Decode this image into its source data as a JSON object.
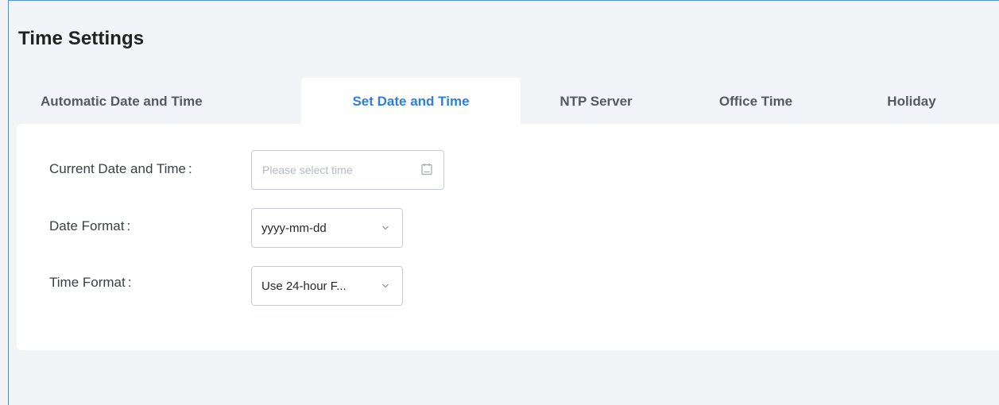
{
  "header": {
    "title": "Time Settings"
  },
  "tabs": [
    {
      "label": "Automatic Date and Time",
      "active": false
    },
    {
      "label": "Set Date and Time",
      "active": true
    },
    {
      "label": "NTP Server",
      "active": false
    },
    {
      "label": "Office Time",
      "active": false
    },
    {
      "label": "Holiday",
      "active": false
    }
  ],
  "form": {
    "current_datetime": {
      "label": "Current Date and Time",
      "colon": ":",
      "placeholder": "Please select time",
      "icon": "calendar-icon"
    },
    "date_format": {
      "label": "Date Format",
      "colon": ":",
      "value": "yyyy-mm-dd",
      "icon": "chevron-down-icon"
    },
    "time_format": {
      "label": "Time Format",
      "colon": ":",
      "value": "Use 24-hour F...",
      "icon": "chevron-down-icon"
    }
  },
  "colors": {
    "accent": "#2f7fd6",
    "background": "#f2f4f8",
    "card": "#ffffff",
    "frame_border": "#5b8fc9"
  }
}
